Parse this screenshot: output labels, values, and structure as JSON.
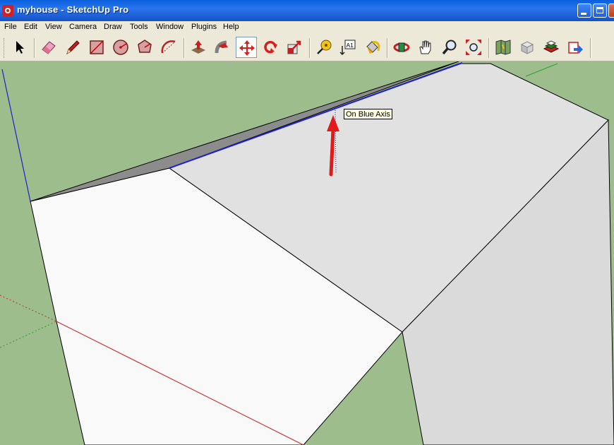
{
  "window": {
    "title": "myhouse - SketchUp Pro"
  },
  "menu": [
    "File",
    "Edit",
    "View",
    "Camera",
    "Draw",
    "Tools",
    "Window",
    "Plugins",
    "Help"
  ],
  "toolbar": {
    "tools": [
      {
        "name": "select",
        "icon": "arrow-cursor-icon"
      },
      {
        "name": "eraser",
        "icon": "eraser-icon"
      },
      {
        "name": "pencil",
        "icon": "pencil-icon"
      },
      {
        "name": "rectangle",
        "icon": "rectangle-icon"
      },
      {
        "name": "circle",
        "icon": "circle-icon"
      },
      {
        "name": "polygon",
        "icon": "polygon-icon"
      },
      {
        "name": "arc",
        "icon": "arc-icon"
      },
      {
        "name": "push-pull",
        "icon": "push-pull-icon"
      },
      {
        "name": "follow-me",
        "icon": "follow-me-icon"
      },
      {
        "name": "move",
        "icon": "move-icon",
        "active": true
      },
      {
        "name": "rotate",
        "icon": "rotate-icon"
      },
      {
        "name": "scale",
        "icon": "scale-icon"
      },
      {
        "name": "tape-measure",
        "icon": "tape-measure-icon"
      },
      {
        "name": "text",
        "icon": "text-icon",
        "label": "A1"
      },
      {
        "name": "paint-bucket",
        "icon": "paint-bucket-icon"
      },
      {
        "name": "orbit",
        "icon": "orbit-icon"
      },
      {
        "name": "pan",
        "icon": "hand-icon"
      },
      {
        "name": "zoom",
        "icon": "zoom-icon"
      },
      {
        "name": "zoom-extents",
        "icon": "zoom-extents-icon"
      },
      {
        "name": "google-earth-view",
        "icon": "map-icon"
      },
      {
        "name": "components",
        "icon": "components-icon"
      },
      {
        "name": "3d-warehouse",
        "icon": "warehouse-icon"
      },
      {
        "name": "share-model",
        "icon": "share-model-icon"
      }
    ]
  },
  "viewport": {
    "inference_tooltip": "On Blue Axis",
    "annotation_arrow_color": "#e31a1a",
    "colors": {
      "ground": "#9dbd8d",
      "roof": "#e0e0e0",
      "front_face": "#f8f8f8",
      "side_face": "#dedede",
      "roof_edge_dark": "#8a8a8a",
      "blue_axis": "#2020d0",
      "red_axis": "#c83030",
      "green_axis": "#2ea02e"
    }
  }
}
